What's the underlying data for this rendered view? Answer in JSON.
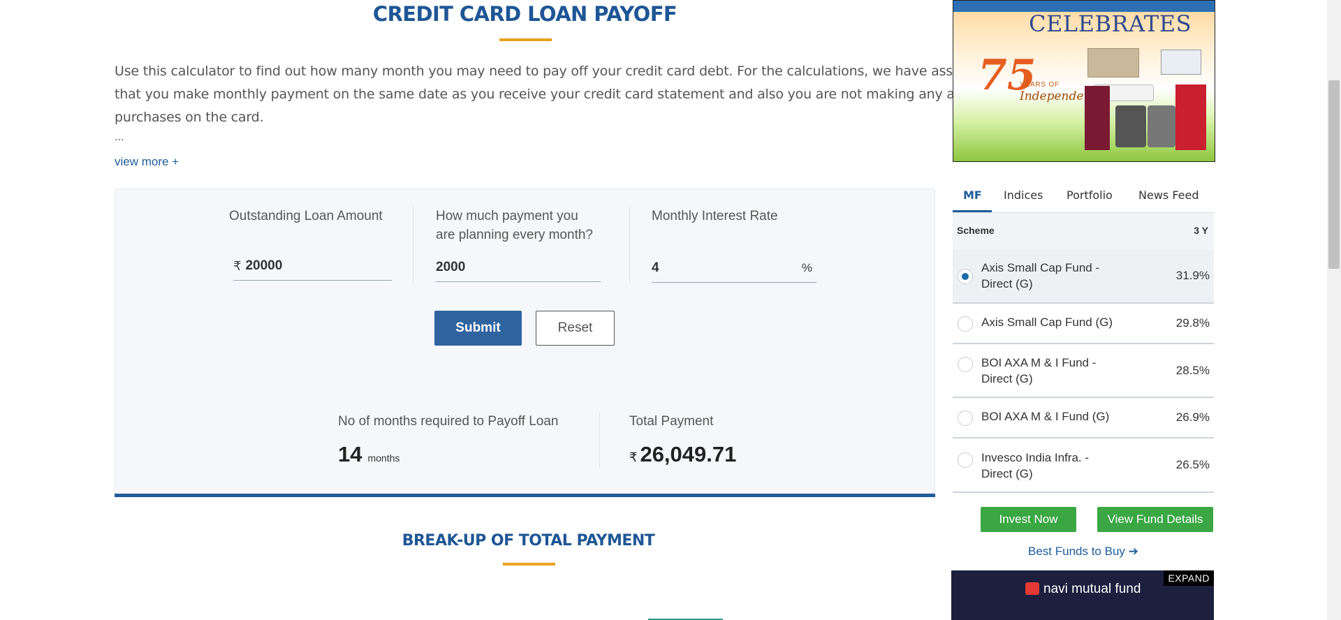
{
  "page": {
    "title": "CREDIT CARD LOAN PAYOFF",
    "description_lines": [
      "Use this calculator to find out how many month you may need to pay off your credit card debt. For the calculations, we have assumed",
      "that you make monthly payment on the same date as you receive your credit card statement and also you are not making any additional",
      "purchases on the card."
    ],
    "ellipsis": "...",
    "view_more": "view more +"
  },
  "form": {
    "outstanding_label": "Outstanding Loan Amount",
    "outstanding_currency": "₹",
    "outstanding_value": "20000",
    "payment_label_line1": "How much payment you",
    "payment_label_line2": "are planning every month?",
    "payment_value": "2000",
    "interest_label": "Monthly Interest Rate",
    "interest_value": "4",
    "interest_unit": "%",
    "submit": "Submit",
    "reset": "Reset"
  },
  "results": {
    "months_label": "No of months required to Payoff Loan",
    "months_value": "14",
    "months_unit": "months",
    "total_label": "Total Payment",
    "total_currency": "₹",
    "total_value": "26,049.71"
  },
  "breakup_title": "BREAK-UP OF TOTAL PAYMENT",
  "ad": {
    "headline": "CELEBRATES",
    "badge_number": "75",
    "badge_years": "YEARS OF",
    "badge_independence": "Independence"
  },
  "widget": {
    "tabs": [
      "MF",
      "Indices",
      "Portfolio",
      "News Feed"
    ],
    "active_tab": "MF",
    "header_scheme": "Scheme",
    "header_return": "3 Y",
    "funds": [
      {
        "name": "Axis Small Cap Fund - Direct (G)",
        "ret": "31.9%"
      },
      {
        "name": "Axis Small Cap Fund (G)",
        "ret": "29.8%"
      },
      {
        "name": "BOI AXA M & I Fund - Direct (G)",
        "ret": "28.5%"
      },
      {
        "name": "BOI AXA M & I Fund (G)",
        "ret": "26.9%"
      },
      {
        "name": "Invesco India Infra. - Direct (G)",
        "ret": "26.5%"
      }
    ],
    "invest_now": "Invest Now",
    "view_fund_details": "View Fund Details",
    "best_funds": "Best Funds to Buy ➔"
  },
  "navi_ad": {
    "expand": "EXPAND",
    "logo_text": "navi mutual fund"
  },
  "colors": {
    "brand_blue": "#1f5695",
    "accent_orange": "#e9a21f",
    "green": "#3aa744"
  }
}
